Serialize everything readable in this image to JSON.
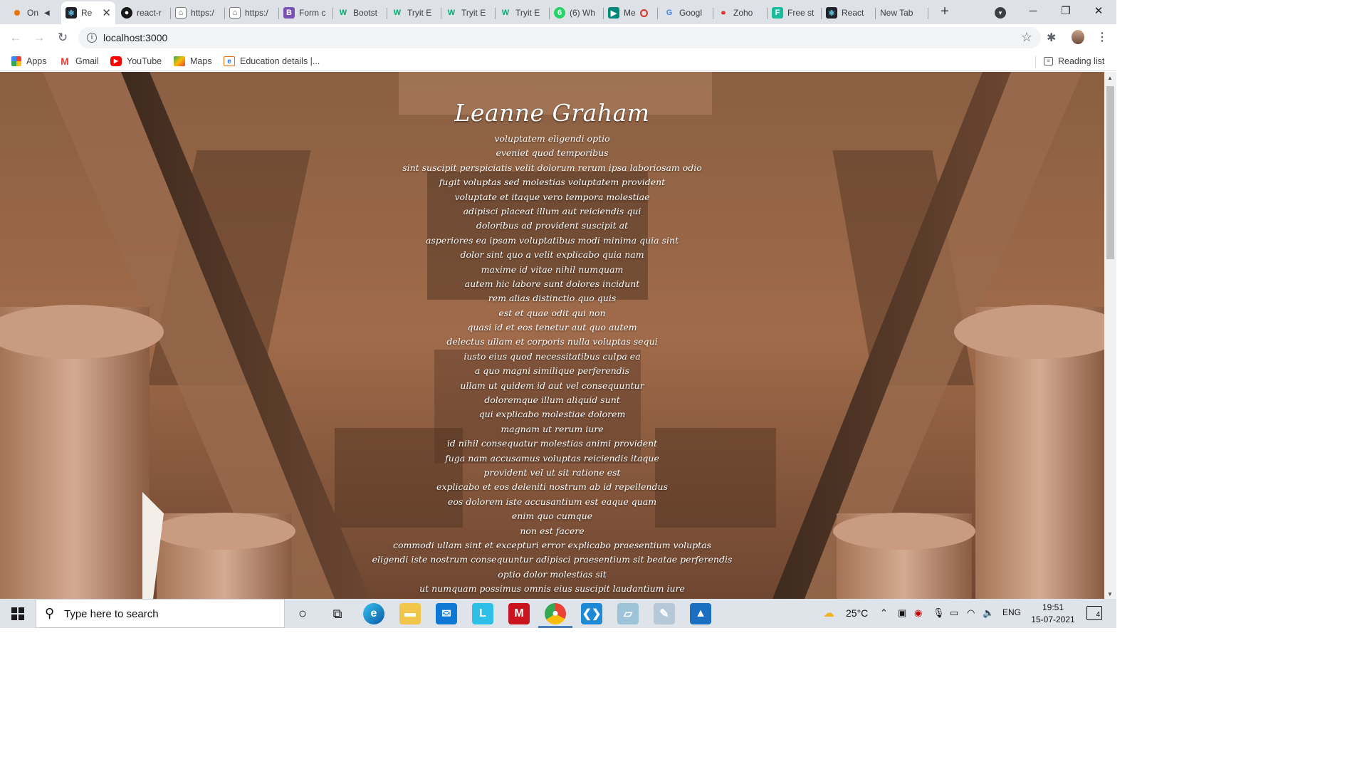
{
  "browser": {
    "tabs": [
      {
        "label": "On",
        "icon": "people-icon",
        "color": "#e8710a"
      },
      {
        "label": "Re",
        "icon": "react-icon",
        "color": "#222"
      },
      {
        "label": "react-r",
        "icon": "github-icon",
        "color": "#181717"
      },
      {
        "label": "https:/",
        "icon": "mirror-icon",
        "color": "#555"
      },
      {
        "label": "https:/",
        "icon": "mirror-icon",
        "color": "#555"
      },
      {
        "label": "Form c",
        "icon": "bootstrap-icon",
        "color": "#7952b3"
      },
      {
        "label": "Bootst",
        "icon": "w3schools-icon",
        "color": "#04aa6d"
      },
      {
        "label": "Tryit E",
        "icon": "w3schools-icon",
        "color": "#04aa6d"
      },
      {
        "label": "Tryit E",
        "icon": "w3schools-icon",
        "color": "#04aa6d"
      },
      {
        "label": "Tryit E",
        "icon": "w3schools-icon",
        "color": "#04aa6d"
      },
      {
        "label": "(6) Wh",
        "icon": "whatsapp-icon",
        "color": "#25d366"
      },
      {
        "label": "Me",
        "icon": "meet-icon",
        "color": "#00897b"
      },
      {
        "label": "Googl",
        "icon": "google-icon",
        "color": "#4285f4"
      },
      {
        "label": "Zoho",
        "icon": "zoho-icon",
        "color": "#e42527"
      },
      {
        "label": "Free st",
        "icon": "freepik-icon",
        "color": "#1bbc9b"
      },
      {
        "label": "React",
        "icon": "react-icon",
        "color": "#222"
      },
      {
        "label": "New Tab",
        "icon": "",
        "color": ""
      }
    ],
    "url": "localhost:3000",
    "bookmarks": [
      {
        "label": "Apps",
        "icon": "apps-grid-icon"
      },
      {
        "label": "Gmail",
        "icon": "gmail-icon"
      },
      {
        "label": "YouTube",
        "icon": "youtube-icon"
      },
      {
        "label": "Maps",
        "icon": "maps-icon"
      },
      {
        "label": "Education details |...",
        "icon": "education-icon"
      }
    ],
    "reading_list": "Reading list"
  },
  "page": {
    "name": "Leanne Graham",
    "titles": [
      "voluptatem eligendi optio",
      "eveniet quod temporibus",
      "sint suscipit perspiciatis velit dolorum rerum ipsa laboriosam odio",
      "fugit voluptas sed molestias voluptatem provident",
      "voluptate et itaque vero tempora molestiae",
      "adipisci placeat illum aut reiciendis qui",
      "doloribus ad provident suscipit at",
      "asperiores ea ipsam voluptatibus modi minima quia sint",
      "dolor sint quo a velit explicabo quia nam",
      "maxime id vitae nihil numquam",
      "autem hic labore sunt dolores incidunt",
      "rem alias distinctio quo quis",
      "est et quae odit qui non",
      "quasi id et eos tenetur aut quo autem",
      "delectus ullam et corporis nulla voluptas sequi",
      "iusto eius quod necessitatibus culpa ea",
      "a quo magni similique perferendis",
      "ullam ut quidem id aut vel consequuntur",
      "doloremque illum aliquid sunt",
      "qui explicabo molestiae dolorem",
      "magnam ut rerum iure",
      "id nihil consequatur molestias animi provident",
      "fuga nam accusamus voluptas reiciendis itaque",
      "provident vel ut sit ratione est",
      "explicabo et eos deleniti nostrum ab id repellendus",
      "eos dolorem iste accusantium est eaque quam",
      "enim quo cumque",
      "non est facere",
      "commodi ullam sint et excepturi error explicabo praesentium voluptas",
      "eligendi iste nostrum consequuntur adipisci praesentium sit beatae perferendis",
      "optio dolor molestias sit",
      "ut numquam possimus omnis eius suscipit laudantium iure"
    ]
  },
  "taskbar": {
    "search_placeholder": "Type here to search",
    "temperature": "25°C",
    "language": "ENG",
    "time": "19:51",
    "date": "15-07-2021",
    "notification_count": "4"
  }
}
